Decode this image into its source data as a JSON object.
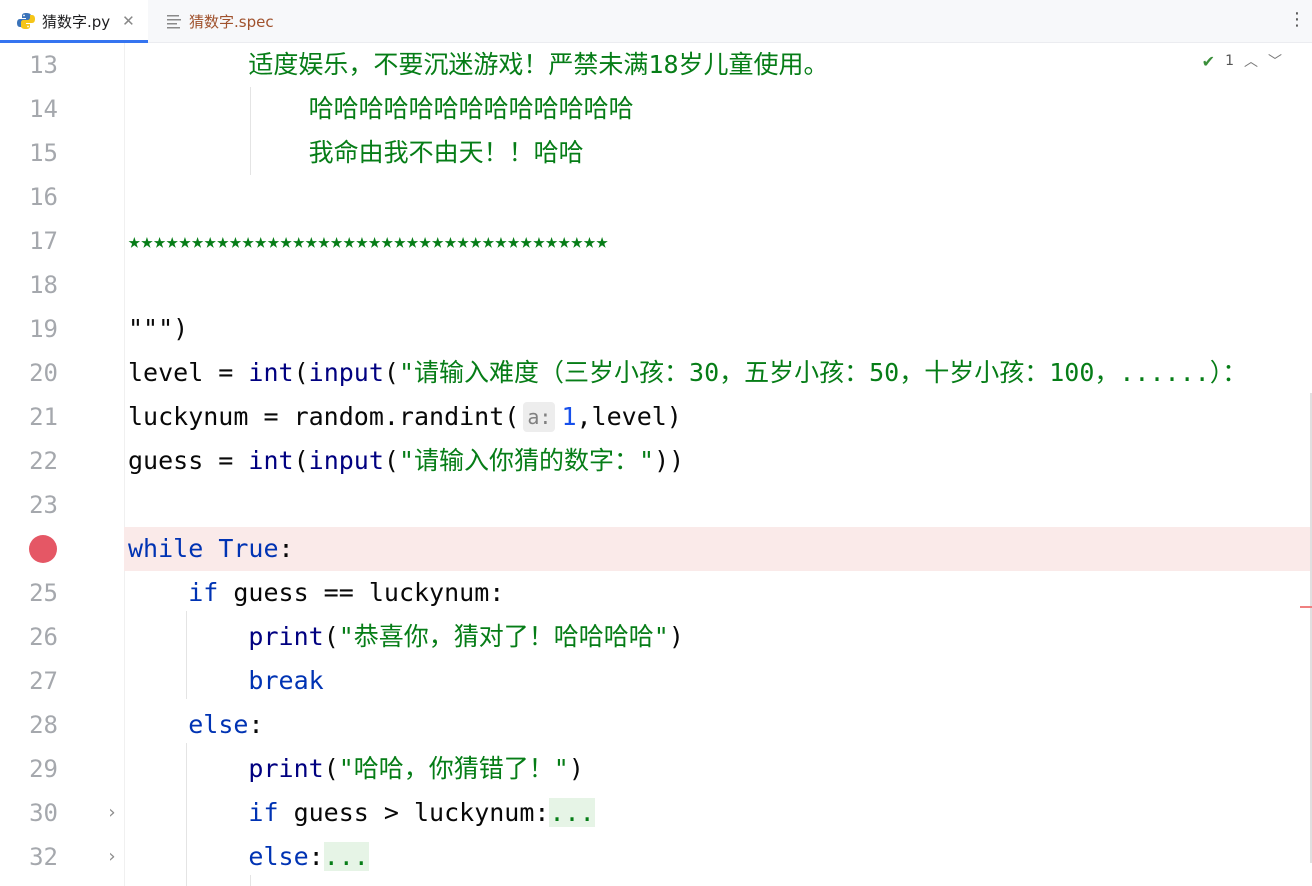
{
  "tabs": [
    {
      "label": "猜数字.py",
      "active": true,
      "icon": "python-file-icon"
    },
    {
      "label": "猜数字.spec",
      "active": false,
      "icon": "text-file-icon"
    }
  ],
  "status": {
    "problems_count": "1"
  },
  "colors": {
    "keyword": "#0033b3",
    "string": "#067d17",
    "number": "#1750eb",
    "breakpoint": "#e55765",
    "tab_accent": "#3574f0"
  },
  "lines": [
    {
      "num": "13",
      "text": "        适度娱乐，不要沉迷游戏！严禁未满18岁儿童使用。"
    },
    {
      "num": "14",
      "text": "            哈哈哈哈哈哈哈哈哈哈哈哈哈"
    },
    {
      "num": "15",
      "text": "            我命由我不由天！！哈哈"
    },
    {
      "num": "16",
      "text": ""
    },
    {
      "num": "17",
      "text": "★★★★★★★★★★★★★★★★★★★★★★★★★★★★★★★★★★★★★★"
    },
    {
      "num": "18",
      "text": ""
    },
    {
      "num": "19",
      "text": "\"\"\")"
    },
    {
      "num": "20",
      "p1": "level = ",
      "p2": "int",
      "p3": "(",
      "p4": "input",
      "p5": "(",
      "str": "\"请输入难度（三岁小孩：30，五岁小孩：50，十岁小孩：100，......）："
    },
    {
      "num": "21",
      "p1": "luckynum = random.randint(",
      "hint": "a:",
      "num_val": "1",
      "p2": ",level)"
    },
    {
      "num": "22",
      "p1": "guess = ",
      "p2": "int",
      "p3": "(",
      "p4": "input",
      "p5": "(",
      "str": "\"请输入你猜的数字：\"",
      "p6": "))"
    },
    {
      "num": "23",
      "text": ""
    },
    {
      "num": "",
      "kw1": "while",
      "sp": " ",
      "kw2": "True",
      "p1": ":"
    },
    {
      "num": "25",
      "ind": "    ",
      "kw": "if",
      "p1": " guess == luckynum:"
    },
    {
      "num": "26",
      "ind": "        ",
      "fn": "print",
      "p1": "(",
      "str": "\"恭喜你，猜对了！哈哈哈哈\"",
      "p2": ")"
    },
    {
      "num": "27",
      "ind": "        ",
      "kw": "break"
    },
    {
      "num": "28",
      "ind": "    ",
      "kw": "else",
      "p1": ":"
    },
    {
      "num": "29",
      "ind": "        ",
      "fn": "print",
      "p1": "(",
      "str": "\"哈哈，你猜错了！\"",
      "p2": ")"
    },
    {
      "num": "30",
      "ind": "        ",
      "kw": "if",
      "p1": " guess > luckynum:",
      "fold": "..."
    },
    {
      "num": "32",
      "ind": "        ",
      "kw": "else",
      "p1": ":",
      "fold": "..."
    }
  ]
}
